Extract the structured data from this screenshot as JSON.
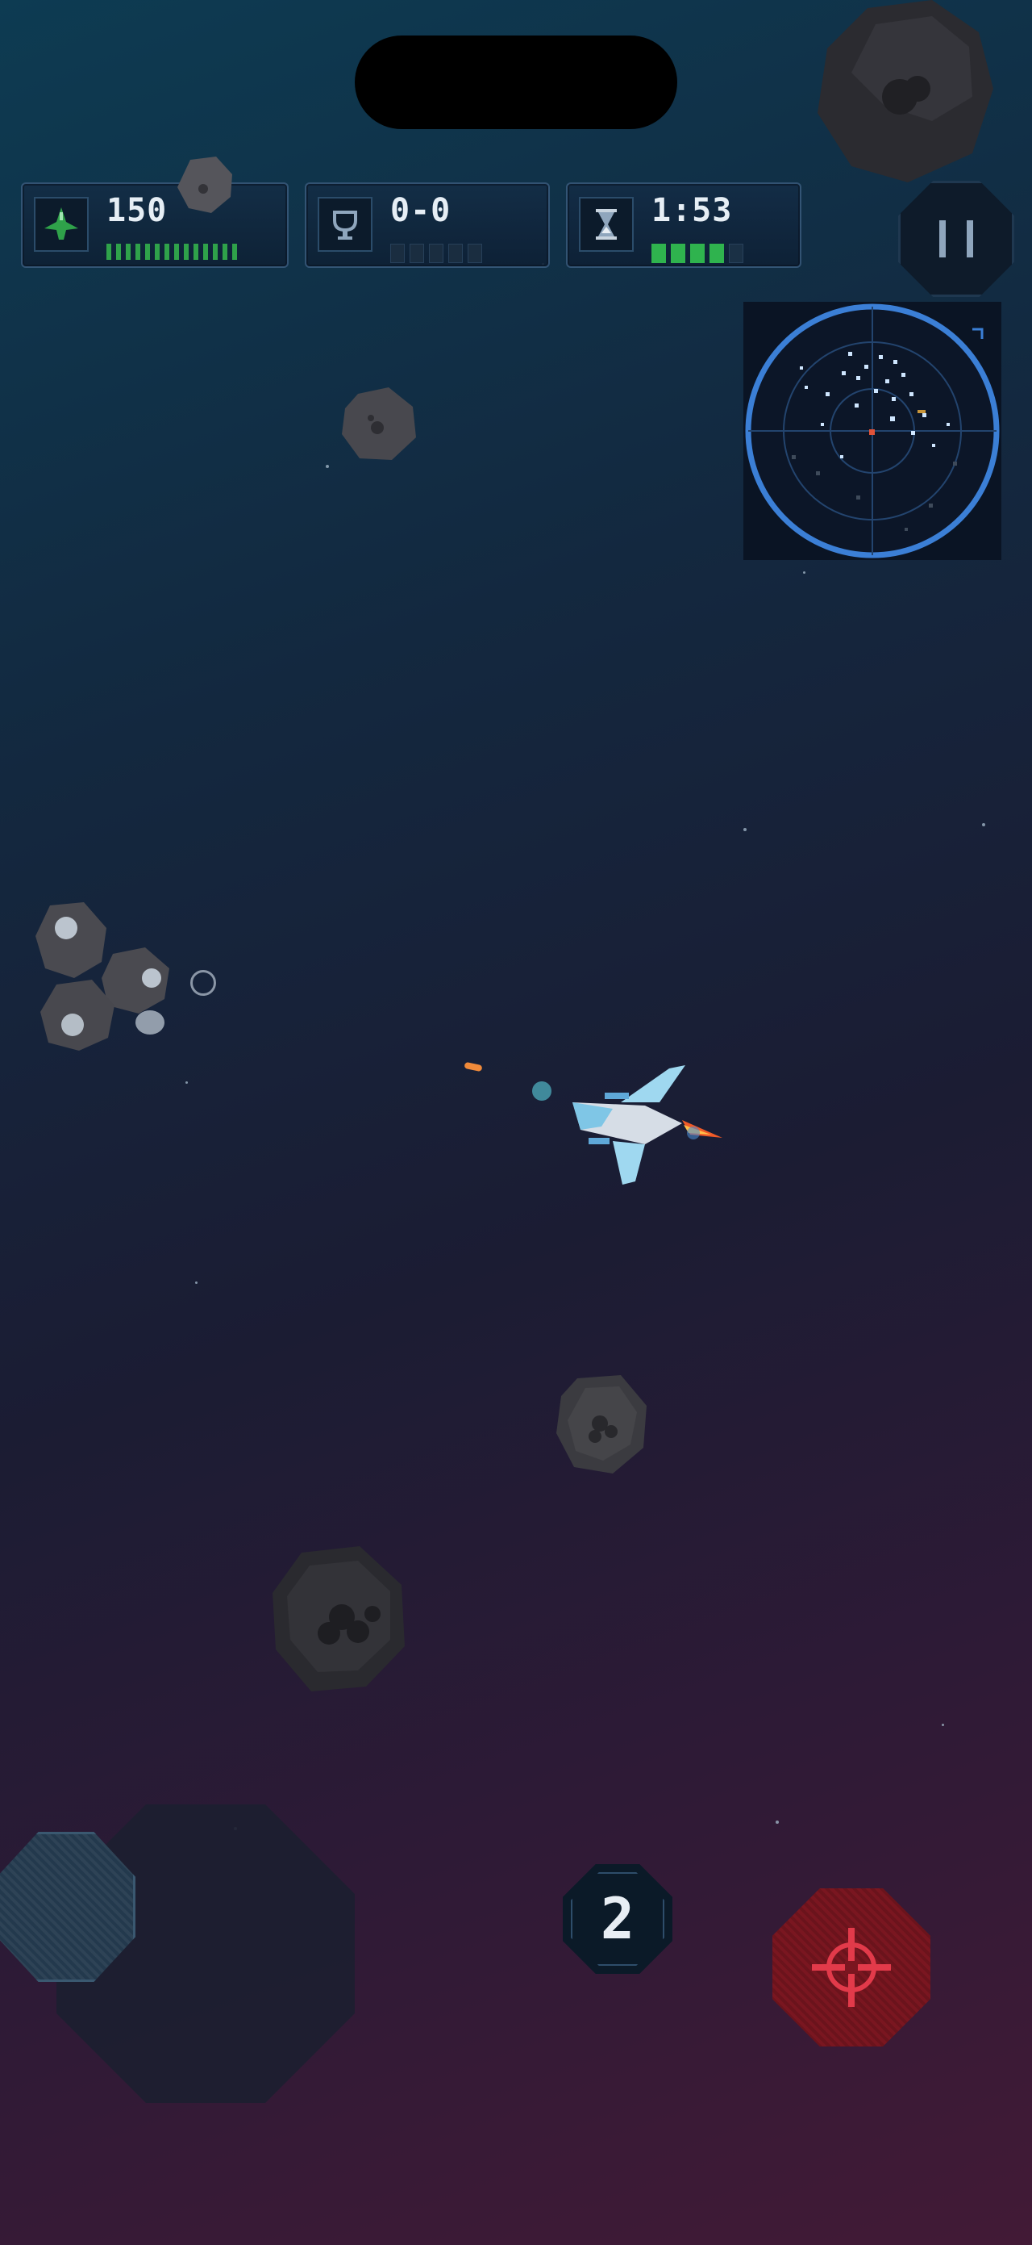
{
  "hud": {
    "score": {
      "icon": "ship-icon",
      "value": "150",
      "accent": "#2fa24a"
    },
    "kills": {
      "icon": "trophy-icon",
      "value": "0-0"
    },
    "timer": {
      "icon": "hourglass-icon",
      "value": "1:53",
      "progress": 0.8,
      "accent": "#2fb34e"
    }
  },
  "controls": {
    "weapon_slot_number": "2",
    "fire_color": "#7a1620",
    "fire_crosshair_color": "#e23a4a"
  },
  "radar": {
    "ring_color": "#3b7fd6"
  }
}
